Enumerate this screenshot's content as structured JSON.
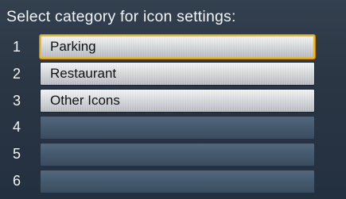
{
  "title": "Select category for icon settings:",
  "items": [
    {
      "number": "1",
      "label": "Parking"
    },
    {
      "number": "2",
      "label": "Restaurant"
    },
    {
      "number": "3",
      "label": "Other Icons"
    },
    {
      "number": "4",
      "label": ""
    },
    {
      "number": "5",
      "label": ""
    },
    {
      "number": "6",
      "label": ""
    }
  ],
  "selected_index": 1,
  "colors": {
    "background": "#2b3644",
    "highlight": "#f1b61c",
    "text_light": "#f2f4f6"
  }
}
